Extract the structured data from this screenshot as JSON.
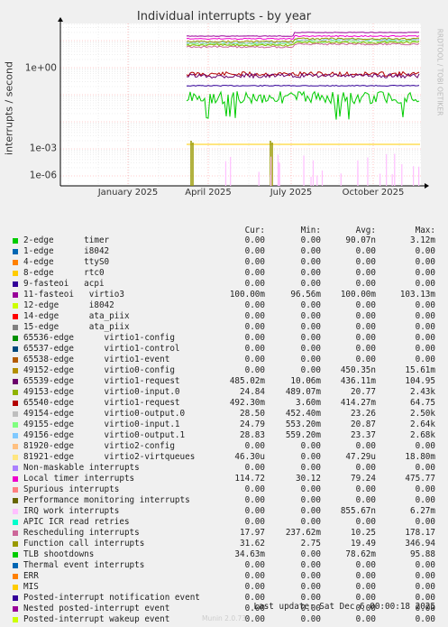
{
  "chart_data": {
    "type": "line",
    "title": "Individual interrupts - by year",
    "ylabel": "interrupts / second",
    "yscale": "log",
    "yticks": [
      "1e+00",
      "1e-03",
      "1e-06"
    ],
    "xticks": [
      "January 2025",
      "April 2025",
      "July 2025",
      "October 2025"
    ],
    "grid": true,
    "legend_headers": [
      "Cur:",
      "Min:",
      "Avg:",
      "Max:"
    ],
    "series": [
      {
        "name": "2-edge      timer",
        "color": "#00cc00",
        "values": [
          "0.00",
          "0.00",
          "90.07n",
          "3.12m"
        ]
      },
      {
        "name": "1-edge      i8042",
        "color": "#0066b3",
        "values": [
          "0.00",
          "0.00",
          "0.00",
          "0.00"
        ]
      },
      {
        "name": "4-edge      ttyS0",
        "color": "#ff8000",
        "values": [
          "0.00",
          "0.00",
          "0.00",
          "0.00"
        ]
      },
      {
        "name": "8-edge      rtc0",
        "color": "#ffcc00",
        "values": [
          "0.00",
          "0.00",
          "0.00",
          "0.00"
        ]
      },
      {
        "name": "9-fasteoi   acpi",
        "color": "#330099",
        "values": [
          "0.00",
          "0.00",
          "0.00",
          "0.00"
        ]
      },
      {
        "name": "11-fasteoi   virtio3",
        "color": "#990099",
        "values": [
          "100.00m",
          "96.56m",
          "100.00m",
          "103.13m"
        ]
      },
      {
        "name": "12-edge      i8042",
        "color": "#ccff00",
        "values": [
          "0.00",
          "0.00",
          "0.00",
          "0.00"
        ]
      },
      {
        "name": "14-edge      ata_piix",
        "color": "#ff0000",
        "values": [
          "0.00",
          "0.00",
          "0.00",
          "0.00"
        ]
      },
      {
        "name": "15-edge      ata_piix",
        "color": "#808080",
        "values": [
          "0.00",
          "0.00",
          "0.00",
          "0.00"
        ]
      },
      {
        "name": "65536-edge      virtio1-config",
        "color": "#008f00",
        "values": [
          "0.00",
          "0.00",
          "0.00",
          "0.00"
        ]
      },
      {
        "name": "65537-edge      virtio1-control",
        "color": "#00487d",
        "values": [
          "0.00",
          "0.00",
          "0.00",
          "0.00"
        ]
      },
      {
        "name": "65538-edge      virtio1-event",
        "color": "#b35a00",
        "values": [
          "0.00",
          "0.00",
          "0.00",
          "0.00"
        ]
      },
      {
        "name": "49152-edge      virtio0-config",
        "color": "#b38f00",
        "values": [
          "0.00",
          "0.00",
          "450.35n",
          "15.61m"
        ]
      },
      {
        "name": "65539-edge      virtio1-request",
        "color": "#6b006b",
        "values": [
          "485.02m",
          "10.06m",
          "436.11m",
          "104.95"
        ]
      },
      {
        "name": "49153-edge      virtio0-input.0",
        "color": "#8fb300",
        "values": [
          "24.84",
          "489.07m",
          "20.77",
          "2.43k"
        ]
      },
      {
        "name": "65540-edge      virtio1-request",
        "color": "#b30000",
        "values": [
          "492.30m",
          "3.60m",
          "414.27m",
          "64.75"
        ]
      },
      {
        "name": "49154-edge      virtio0-output.0",
        "color": "#bebebe",
        "values": [
          "28.50",
          "452.40m",
          "23.26",
          "2.50k"
        ]
      },
      {
        "name": "49155-edge      virtio0-input.1",
        "color": "#80ff80",
        "values": [
          "24.79",
          "553.20m",
          "20.87",
          "2.64k"
        ]
      },
      {
        "name": "49156-edge      virtio0-output.1",
        "color": "#80c9ff",
        "values": [
          "28.83",
          "559.20m",
          "23.37",
          "2.68k"
        ]
      },
      {
        "name": "81920-edge      virtio2-config",
        "color": "#ffc080",
        "values": [
          "0.00",
          "0.00",
          "0.00",
          "0.00"
        ]
      },
      {
        "name": "81921-edge      virtio2-virtqueues",
        "color": "#ffe680",
        "values": [
          "46.30u",
          "0.00",
          "47.29u",
          "18.80m"
        ]
      },
      {
        "name": "Non-maskable interrupts",
        "color": "#aa80ff",
        "values": [
          "0.00",
          "0.00",
          "0.00",
          "0.00"
        ]
      },
      {
        "name": "Local timer interrupts",
        "color": "#ee00cc",
        "values": [
          "114.72",
          "30.12",
          "79.24",
          "475.77"
        ]
      },
      {
        "name": "Spurious interrupts",
        "color": "#ff8080",
        "values": [
          "0.00",
          "0.00",
          "0.00",
          "0.00"
        ]
      },
      {
        "name": "Performance monitoring interrupts",
        "color": "#666600",
        "values": [
          "0.00",
          "0.00",
          "0.00",
          "0.00"
        ]
      },
      {
        "name": "IRQ work interrupts",
        "color": "#ffbfff",
        "values": [
          "0.00",
          "0.00",
          "855.67n",
          "6.27m"
        ]
      },
      {
        "name": "APIC ICR read retries",
        "color": "#00ffcc",
        "values": [
          "0.00",
          "0.00",
          "0.00",
          "0.00"
        ]
      },
      {
        "name": "Rescheduling interrupts",
        "color": "#cc6699",
        "values": [
          "17.97",
          "237.62m",
          "10.25",
          "178.17"
        ]
      },
      {
        "name": "Function call interrupts",
        "color": "#999900",
        "values": [
          "31.62",
          "2.75",
          "19.49",
          "346.94"
        ]
      },
      {
        "name": "TLB shootdowns",
        "color": "#00cc00",
        "values": [
          "34.63m",
          "0.00",
          "78.62m",
          "95.88"
        ]
      },
      {
        "name": "Thermal event interrupts",
        "color": "#0066b3",
        "values": [
          "0.00",
          "0.00",
          "0.00",
          "0.00"
        ]
      },
      {
        "name": "ERR",
        "color": "#ff8000",
        "values": [
          "0.00",
          "0.00",
          "0.00",
          "0.00"
        ]
      },
      {
        "name": "MIS",
        "color": "#ffcc00",
        "values": [
          "0.00",
          "0.00",
          "0.00",
          "0.00"
        ]
      },
      {
        "name": "Posted-interrupt notification event",
        "color": "#330099",
        "values": [
          "0.00",
          "0.00",
          "0.00",
          "0.00"
        ]
      },
      {
        "name": "Nested posted-interrupt event",
        "color": "#990099",
        "values": [
          "0.00",
          "0.00",
          "0.00",
          "0.00"
        ]
      },
      {
        "name": "Posted-interrupt wakeup event",
        "color": "#ccff00",
        "values": [
          "0.00",
          "0.00",
          "0.00",
          "0.00"
        ]
      }
    ]
  },
  "footer": "Last update: Sat Dec  6 00:00:18 2025",
  "side_label": "RRDTOOL / TOBI OETIKER",
  "generator": "Munin 2.0.73"
}
